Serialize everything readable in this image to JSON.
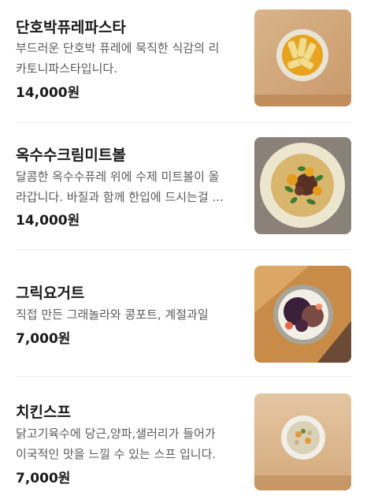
{
  "menu": {
    "items": [
      {
        "name": "단호박퓨레파스타",
        "description_lines": [
          "부드러운 단호박 퓨레에 묵직한 식감의 리",
          "카토니파스타입니다."
        ],
        "price": "14,000원",
        "photo_icon": "pumpkin-pasta-photo"
      },
      {
        "name": "옥수수크림미트볼",
        "description_lines": [
          "달콤한 옥수수퓨레 위에 수제 미트볼이 올",
          "라갑니다. 바질과 함께 한입에 드시는걸 ..."
        ],
        "price": "14,000원",
        "photo_icon": "corn-meatball-photo"
      },
      {
        "name": "그릭요거트",
        "description_lines": [
          "직접 만든 그래놀라와 콩포트, 계절과일"
        ],
        "price": "7,000원",
        "photo_icon": "greek-yogurt-photo"
      },
      {
        "name": "치킨스프",
        "description_lines": [
          "닭고기육수에 당근,양파,샐러리가 들어가",
          "이국적인 맛을 느낄 수 있는 스프 입니다."
        ],
        "price": "7,000원",
        "photo_icon": "chicken-soup-photo"
      }
    ]
  }
}
